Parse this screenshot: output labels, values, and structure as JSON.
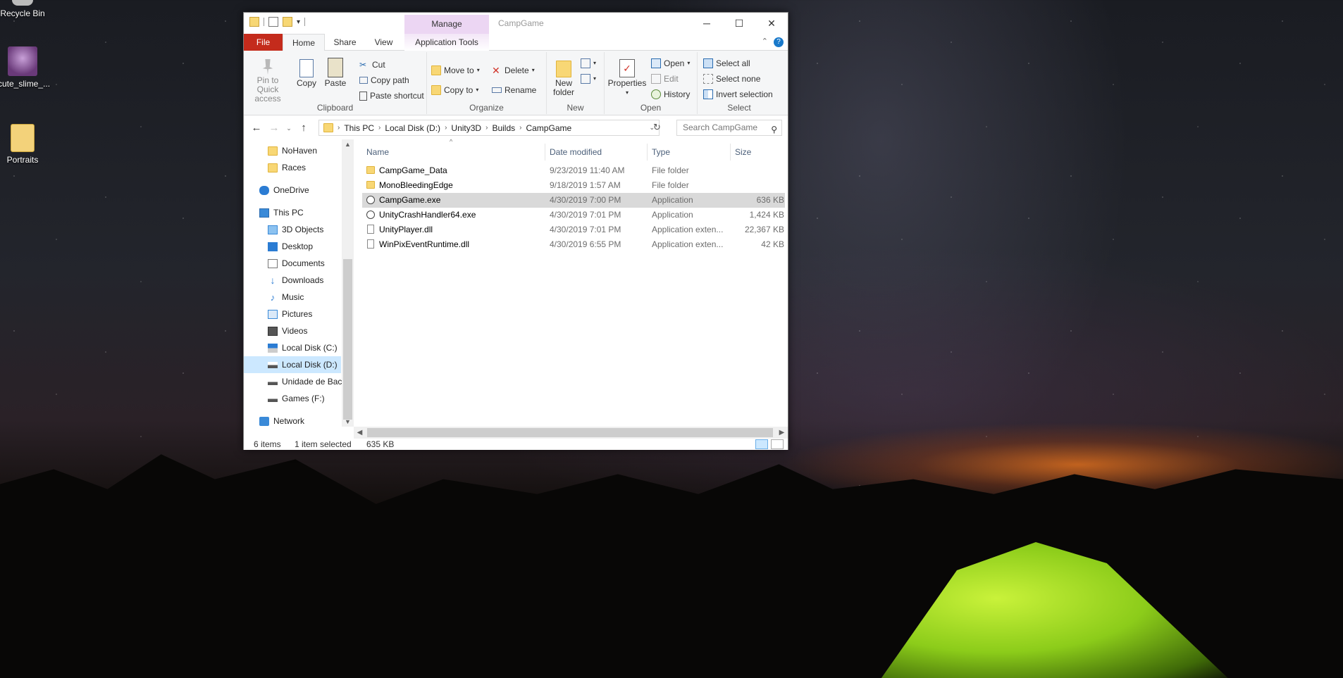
{
  "desktop": {
    "icons": [
      {
        "label": "Recycle Bin"
      },
      {
        "label": "cute_slime_..."
      },
      {
        "label": "Portraits"
      }
    ]
  },
  "window": {
    "title": "CampGame",
    "manage_tab": "Manage",
    "controls": {
      "minimize": "─",
      "maximize": "☐",
      "close": "✕"
    },
    "tabs": {
      "file": "File",
      "home": "Home",
      "share": "Share",
      "view": "View",
      "app_tools": "Application Tools"
    },
    "help": "?"
  },
  "ribbon": {
    "clipboard": {
      "label": "Clipboard",
      "pin": "Pin to Quick access",
      "copy": "Copy",
      "paste": "Paste",
      "cut": "Cut",
      "copy_path": "Copy path",
      "paste_shortcut": "Paste shortcut"
    },
    "organize": {
      "label": "Organize",
      "move_to": "Move to",
      "copy_to": "Copy to",
      "delete": "Delete",
      "rename": "Rename"
    },
    "new": {
      "label": "New",
      "new_folder": "New folder"
    },
    "open": {
      "label": "Open",
      "properties": "Properties",
      "open": "Open",
      "edit": "Edit",
      "history": "History"
    },
    "select": {
      "label": "Select",
      "select_all": "Select all",
      "select_none": "Select none",
      "invert": "Invert selection"
    }
  },
  "address": {
    "crumbs": [
      "This PC",
      "Local Disk (D:)",
      "Unity3D",
      "Builds",
      "CampGame"
    ],
    "search_placeholder": "Search CampGame"
  },
  "nav": {
    "items": [
      {
        "label": "NoHaven"
      },
      {
        "label": "Races"
      },
      {
        "label": "OneDrive"
      },
      {
        "label": "This PC"
      },
      {
        "label": "3D Objects"
      },
      {
        "label": "Desktop"
      },
      {
        "label": "Documents"
      },
      {
        "label": "Downloads"
      },
      {
        "label": "Music"
      },
      {
        "label": "Pictures"
      },
      {
        "label": "Videos"
      },
      {
        "label": "Local Disk (C:)"
      },
      {
        "label": "Local Disk (D:)"
      },
      {
        "label": "Unidade de Back"
      },
      {
        "label": "Games (F:)"
      },
      {
        "label": "Network"
      }
    ]
  },
  "columns": {
    "name": "Name",
    "date": "Date modified",
    "type": "Type",
    "size": "Size"
  },
  "files": [
    {
      "name": "CampGame_Data",
      "date": "9/23/2019 11:40 AM",
      "type": "File folder",
      "size": ""
    },
    {
      "name": "MonoBleedingEdge",
      "date": "9/18/2019 1:57 AM",
      "type": "File folder",
      "size": ""
    },
    {
      "name": "CampGame.exe",
      "date": "4/30/2019 7:00 PM",
      "type": "Application",
      "size": "636 KB"
    },
    {
      "name": "UnityCrashHandler64.exe",
      "date": "4/30/2019 7:01 PM",
      "type": "Application",
      "size": "1,424 KB"
    },
    {
      "name": "UnityPlayer.dll",
      "date": "4/30/2019 7:01 PM",
      "type": "Application exten...",
      "size": "22,367 KB"
    },
    {
      "name": "WinPixEventRuntime.dll",
      "date": "4/30/2019 6:55 PM",
      "type": "Application exten...",
      "size": "42 KB"
    }
  ],
  "status": {
    "count": "6 items",
    "selected": "1 item selected",
    "size": "635 KB"
  }
}
